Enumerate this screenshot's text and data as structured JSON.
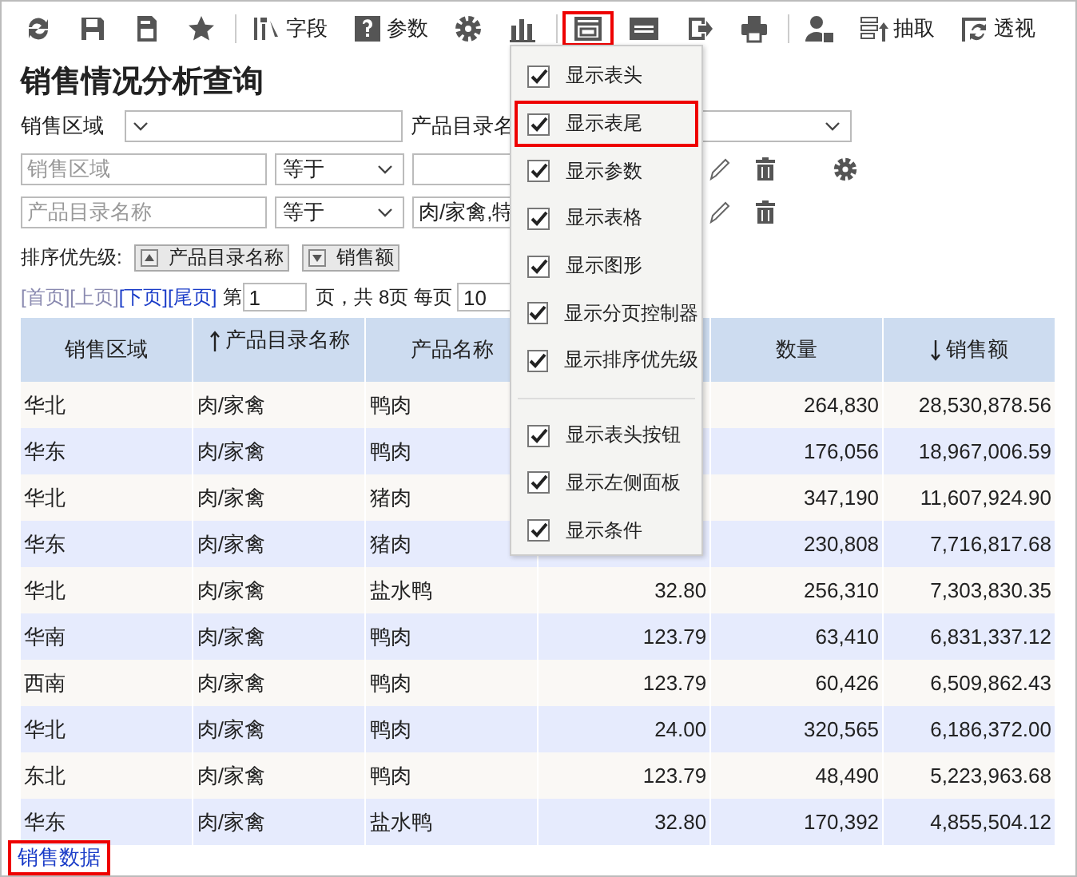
{
  "toolbar": [
    {
      "kind": "refresh",
      "selected": false
    },
    {
      "kind": "save",
      "selected": false
    },
    {
      "kind": "save-as",
      "selected": false
    },
    {
      "kind": "star",
      "selected": false
    },
    {
      "kind": "divider"
    },
    {
      "kind": "field",
      "label": "字段",
      "selected": false
    },
    {
      "kind": "help",
      "label": "参数",
      "selected": false
    },
    {
      "kind": "gear",
      "selected": false
    },
    {
      "kind": "chart",
      "selected": false
    },
    {
      "kind": "divider"
    },
    {
      "kind": "layout",
      "selected": true
    },
    {
      "kind": "sql",
      "selected": false
    },
    {
      "kind": "export",
      "selected": false
    },
    {
      "kind": "print",
      "selected": false
    },
    {
      "kind": "divider"
    },
    {
      "kind": "user",
      "selected": false
    },
    {
      "kind": "extract",
      "label": "抽取",
      "selected": false
    },
    {
      "kind": "pivot",
      "label": "透视",
      "selected": false
    }
  ],
  "title": "销售情况分析查询",
  "filter": {
    "label": "销售区域",
    "label_2": "产品目录名"
  },
  "conditions": [
    {
      "field_placeholder": "销售区域",
      "operator": "等于",
      "actions": [
        {
          "kind": "edit"
        },
        {
          "kind": "delete"
        },
        {
          "kind": "settings"
        }
      ]
    },
    {
      "field_placeholder": "产品目录名称",
      "operator": "等于",
      "value": "肉/家禽,特",
      "actions": [
        {
          "kind": "edit"
        },
        {
          "kind": "delete"
        }
      ]
    }
  ],
  "sort": {
    "label": "排序优先级:",
    "items": [
      {
        "label": "产品目录名称",
        "kind": "asc"
      },
      {
        "label": "销售额",
        "kind": "desc"
      }
    ]
  },
  "pager": {
    "links": [
      {
        "label": "[首页]",
        "disabled": true
      },
      {
        "label": "[上页]",
        "disabled": true
      },
      {
        "label": "[下页]",
        "disabled": false
      },
      {
        "label": "[尾页]",
        "disabled": false
      }
    ],
    "page_prefix": "第",
    "page": "1",
    "page_suffix": "页，共 8页 每页",
    "page_size": "10"
  },
  "table": {
    "columns": [
      {
        "label": "销售区域"
      },
      {
        "label": "产品目录名称",
        "kind": "asc"
      },
      {
        "label": "产品名称"
      },
      {},
      {
        "label": "数量"
      },
      {
        "label": "销售额",
        "kind": "desc"
      }
    ],
    "rows": [
      [
        "华北",
        "肉/家禽",
        "鸭肉",
        null,
        "264,830",
        "28,530,878.56"
      ],
      [
        "华东",
        "肉/家禽",
        "鸭肉",
        null,
        "176,056",
        "18,967,006.59"
      ],
      [
        "华北",
        "肉/家禽",
        "猪肉",
        null,
        "347,190",
        "11,607,924.90"
      ],
      [
        "华东",
        "肉/家禽",
        "猪肉",
        null,
        "230,808",
        "7,716,817.68"
      ],
      [
        "华北",
        "肉/家禽",
        "盐水鸭",
        "32.80",
        "256,310",
        "7,303,830.35"
      ],
      [
        "华南",
        "肉/家禽",
        "鸭肉",
        "123.79",
        "63,410",
        "6,831,337.12"
      ],
      [
        "西南",
        "肉/家禽",
        "鸭肉",
        "123.79",
        "60,426",
        "6,509,862.43"
      ],
      [
        "华北",
        "肉/家禽",
        "鸭肉",
        "24.00",
        "320,565",
        "6,186,372.00"
      ],
      [
        "东北",
        "肉/家禽",
        "鸭肉",
        "123.79",
        "48,490",
        "5,223,963.68"
      ],
      [
        "华东",
        "肉/家禽",
        "盐水鸭",
        "32.80",
        "170,392",
        "4,855,504.12"
      ]
    ]
  },
  "footer": {
    "link": "销售数据",
    "selected": true
  },
  "menu": {
    "groups": [
      [
        {
          "label": "显示表头",
          "checked": true,
          "selected": false
        },
        {
          "label": "显示表尾",
          "checked": true,
          "selected": true
        },
        {
          "label": "显示参数",
          "checked": true,
          "selected": false
        },
        {
          "label": "显示表格",
          "checked": true,
          "selected": false
        },
        {
          "label": "显示图形",
          "checked": true,
          "selected": false
        },
        {
          "label": "显示分页控制器",
          "checked": true,
          "selected": false
        },
        {
          "label": "显示排序优先级",
          "checked": true,
          "selected": false
        }
      ],
      [
        {
          "label": "显示表头按钮",
          "checked": true,
          "selected": false
        },
        {
          "label": "显示左侧面板",
          "checked": true,
          "selected": false
        },
        {
          "label": "显示条件",
          "checked": true,
          "selected": false
        }
      ]
    ]
  }
}
